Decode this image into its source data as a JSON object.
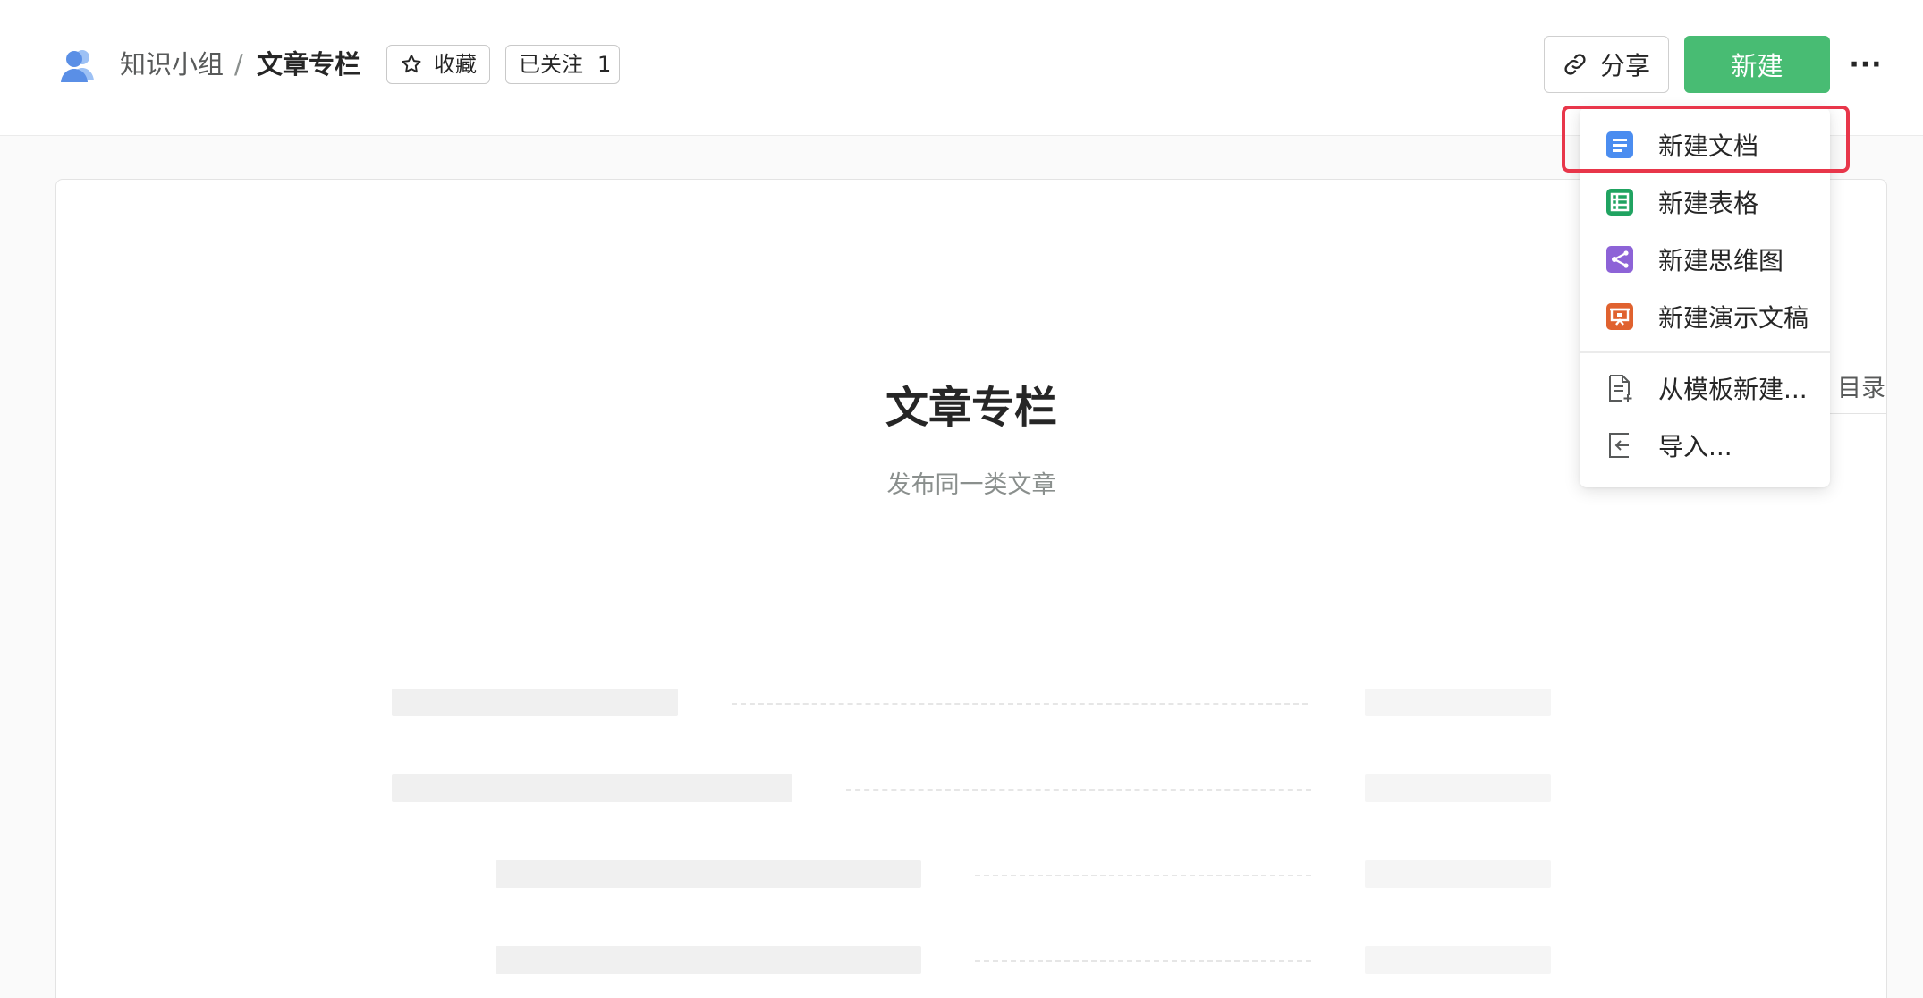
{
  "header": {
    "breadcrumb": {
      "group": "知识小组",
      "separator": "/",
      "current": "文章专栏"
    },
    "favorite_label": "收藏",
    "follow_label": "已关注",
    "follow_count": "1",
    "share_label": "分享",
    "new_label": "新建",
    "more_label": "···"
  },
  "book": {
    "title": "文章专栏",
    "description": "发布同一类文章"
  },
  "toc_label": "目录",
  "new_menu": {
    "items": [
      {
        "label": "新建文档",
        "icon": "doc-icon",
        "color": "#4b8df0"
      },
      {
        "label": "新建表格",
        "icon": "sheet-icon",
        "color": "#20a361"
      },
      {
        "label": "新建思维图",
        "icon": "mindmap-icon",
        "color": "#8d63d7"
      },
      {
        "label": "新建演示文稿",
        "icon": "slides-icon",
        "color": "#e0622f"
      },
      {
        "label": "从模板新建...",
        "icon": "template-icon",
        "color": "#585a5a"
      },
      {
        "label": "导入...",
        "icon": "import-icon",
        "color": "#585a5a"
      }
    ],
    "highlighted_item": "新建文档",
    "highlight_color": "#e8364a"
  },
  "colors": {
    "primary_green": "#48bc73",
    "text": "#262626",
    "muted": "#8a8f8d"
  }
}
